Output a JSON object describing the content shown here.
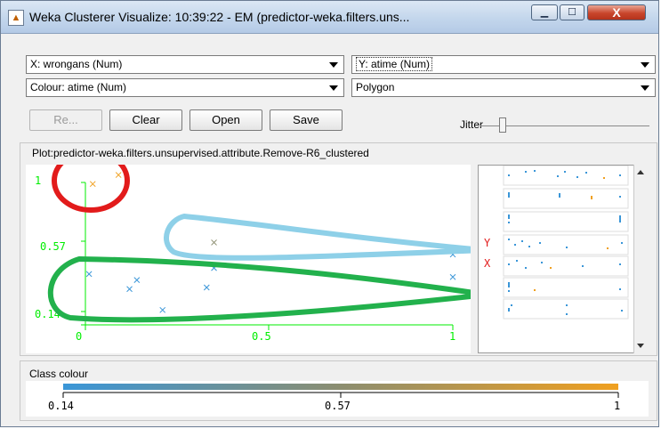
{
  "window": {
    "title": "Weka Clusterer Visualize: 10:39:22 - EM (predictor-weka.filters.uns...",
    "min_glyph": "▁",
    "max_glyph": "☐",
    "close_glyph": "X"
  },
  "controls": {
    "x_axis": "X: wrongans (Num)",
    "y_axis": "Y: atime (Num)",
    "colour": "Colour: atime (Num)",
    "shape": "Polygon",
    "buttons": {
      "reset": "Re...",
      "clear": "Clear",
      "open": "Open",
      "save": "Save"
    },
    "jitter_label": "Jitter",
    "jitter_value": 0.13
  },
  "plot": {
    "title": "Plot:predictor-weka.filters.unsupervised.attribute.Remove-R6_clustered",
    "x_ticks": [
      "0",
      "0.5",
      "1"
    ],
    "y_ticks": [
      "1",
      "0.57",
      "0.14"
    ],
    "matrix_markers": {
      "y": "Y",
      "x": "X"
    },
    "colors": {
      "axis": "#00ee00",
      "low": "#3a96d8",
      "high": "#f0a020",
      "red_annotation": "#e21b1b",
      "blue_annotation": "#8ed0e8",
      "green_annotation": "#22b14c"
    }
  },
  "chart_data": {
    "type": "scatter",
    "title": "Plot:predictor-weka.filters.unsupervised.attribute.Remove-R6_clustered",
    "xlabel": "X: wrongans (Num)",
    "ylabel": "Y: atime (Num)",
    "xlim": [
      0,
      1
    ],
    "ylim": [
      0.14,
      1
    ],
    "points": [
      {
        "x": 0.09,
        "y": 1.05,
        "c": "high"
      },
      {
        "x": 0.02,
        "y": 0.99,
        "c": "high"
      },
      {
        "x": 0.35,
        "y": 0.6,
        "c": "mid"
      },
      {
        "x": 0.35,
        "y": 0.43,
        "c": "low"
      },
      {
        "x": 0.01,
        "y": 0.39,
        "c": "low"
      },
      {
        "x": 0.14,
        "y": 0.35,
        "c": "low"
      },
      {
        "x": 0.12,
        "y": 0.29,
        "c": "low"
      },
      {
        "x": 0.33,
        "y": 0.3,
        "c": "low"
      },
      {
        "x": 0.21,
        "y": 0.15,
        "c": "low"
      },
      {
        "x": 1.0,
        "y": 0.52,
        "c": "low"
      },
      {
        "x": 1.0,
        "y": 0.37,
        "c": "low"
      }
    ]
  },
  "class_colour": {
    "label": "Class colour",
    "ticks": [
      "0.14",
      "0.57",
      "1"
    ]
  }
}
